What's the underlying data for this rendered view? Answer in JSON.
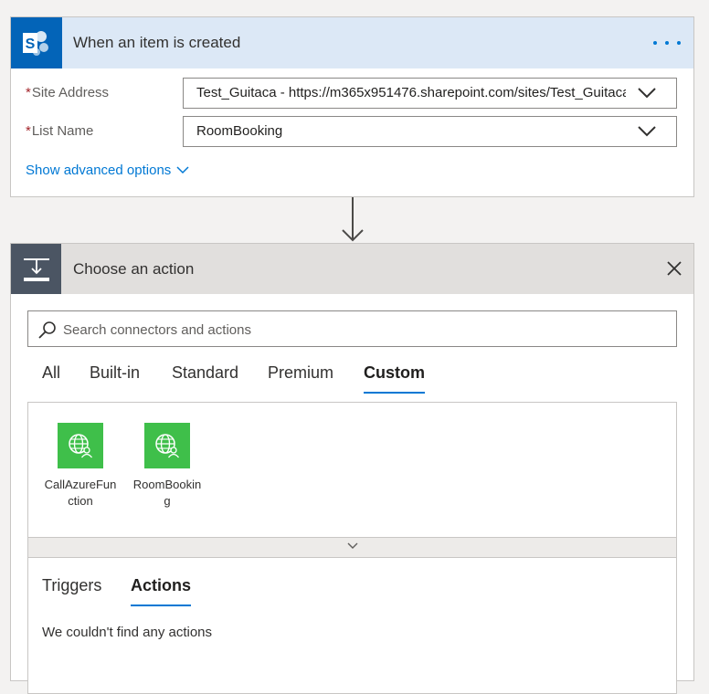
{
  "trigger": {
    "title": "When an item is created",
    "icon": "sharepoint-icon",
    "fields": [
      {
        "label": "Site Address",
        "required_mark": "*",
        "value": "Test_Guitaca - https://m365x951476.sharepoint.com/sites/Test_Guitaca"
      },
      {
        "label": "List Name",
        "required_mark": "*",
        "value": "RoomBooking"
      }
    ],
    "advanced_label": "Show advanced options"
  },
  "action": {
    "title": "Choose an action",
    "search_placeholder": "Search connectors and actions",
    "tabs": [
      "All",
      "Built-in",
      "Standard",
      "Premium",
      "Custom"
    ],
    "active_tab": "Custom",
    "connectors": [
      {
        "label": "CallAzureFunction",
        "icon": "globe-user-icon"
      },
      {
        "label": "RoomBooking",
        "icon": "globe-user-icon"
      }
    ],
    "subtabs": [
      "Triggers",
      "Actions"
    ],
    "active_subtab": "Actions",
    "empty_message": "We couldn't find any actions"
  },
  "colors": {
    "accent": "#0078d4",
    "sharepoint": "#0364b8",
    "connector_green": "#3fbf4a",
    "required": "#a4262c"
  }
}
